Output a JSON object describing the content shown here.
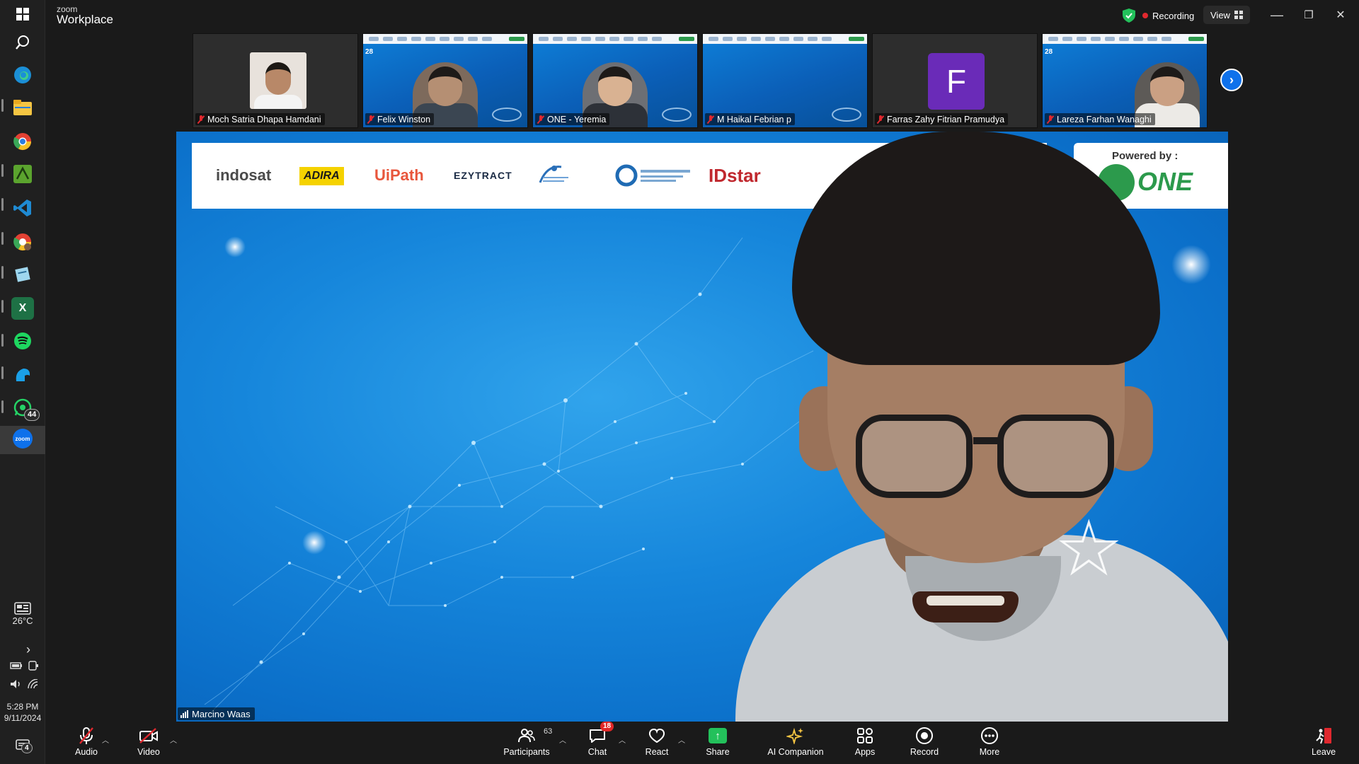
{
  "window": {
    "brand_small": "zoom",
    "brand_big": "Workplace",
    "recording_label": "Recording",
    "view_label": "View",
    "controls": {
      "minimize": "—",
      "restore": "❐",
      "close": "✕"
    }
  },
  "taskbar": {
    "weather_temp": "26°C",
    "time": "5:28 PM",
    "date": "9/11/2024",
    "whatsapp_badge": "44",
    "notification_badge": "4",
    "zoom_label": "zoom",
    "excel_label": "X"
  },
  "strip": {
    "tiles": [
      {
        "name": "Moch Satria Dhapa Hamdani",
        "kind": "photo"
      },
      {
        "name": "Felix Winston",
        "kind": "banner",
        "date": "28"
      },
      {
        "name": "ONE - Yeremia",
        "kind": "banner"
      },
      {
        "name": "M Haikal Febrian p",
        "kind": "banner"
      },
      {
        "name": "Farras Zahy Fitrian Pramudya",
        "kind": "letter",
        "letter": "F"
      },
      {
        "name": "Lareza Farhan Wanaghi",
        "kind": "banner",
        "date": "28"
      }
    ],
    "next_label": "›"
  },
  "main": {
    "speaker_name": "Marcino Waas",
    "sponsors": [
      {
        "name": "indosat",
        "color": "#4a4a4a"
      },
      {
        "name": "ADIRA",
        "color": "#1a1a1a"
      },
      {
        "name": "UiPath",
        "color": "#e8563c"
      },
      {
        "name": "EZYTRACT",
        "color": "#1a2a44"
      },
      {
        "name": "IDstar",
        "color": "#c0282e"
      }
    ],
    "powered_by": "Powered by :",
    "powered_logo_text": "ONE"
  },
  "controls": {
    "audio": "Audio",
    "video": "Video",
    "participants": "Participants",
    "participants_count": "63",
    "chat": "Chat",
    "chat_badge": "18",
    "react": "React",
    "share": "Share",
    "ai_companion": "AI Companion",
    "apps": "Apps",
    "record": "Record",
    "more": "More",
    "leave": "Leave"
  },
  "colors": {
    "accent_blue": "#0e71eb",
    "record_red": "#e0282e",
    "share_green": "#23c15b",
    "slide_blue": "#1686db"
  }
}
